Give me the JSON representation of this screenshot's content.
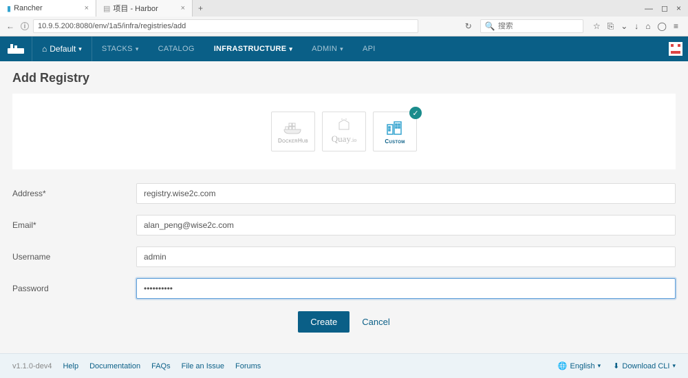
{
  "browser": {
    "tabs": [
      {
        "title": "Rancher",
        "active": true
      },
      {
        "title": "项目 - Harbor",
        "active": false
      }
    ],
    "url": "10.9.5.200:8080/env/1a5/infra/registries/add",
    "search_placeholder": "搜索"
  },
  "header": {
    "env_label": "Default",
    "menu": {
      "stacks": "STACKS",
      "catalog": "CATALOG",
      "infrastructure": "INFRASTRUCTURE",
      "admin": "ADMIN",
      "api": "API"
    }
  },
  "page": {
    "title": "Add Registry",
    "registry_options": {
      "dockerhub": "DockerHub",
      "quay": "Quay",
      "quay_suffix": ".io",
      "custom": "Custom"
    },
    "form": {
      "address_label": "Address*",
      "address_value": "registry.wise2c.com",
      "email_label": "Email*",
      "email_value": "alan_peng@wise2c.com",
      "username_label": "Username",
      "username_value": "admin",
      "password_label": "Password",
      "password_value": "••••••••••"
    },
    "actions": {
      "create": "Create",
      "cancel": "Cancel"
    }
  },
  "footer": {
    "version": "v1.1.0-dev4",
    "links": {
      "help": "Help",
      "documentation": "Documentation",
      "faqs": "FAQs",
      "file_issue": "File an Issue",
      "forums": "Forums"
    },
    "language": "English",
    "download_cli": "Download CLI"
  }
}
